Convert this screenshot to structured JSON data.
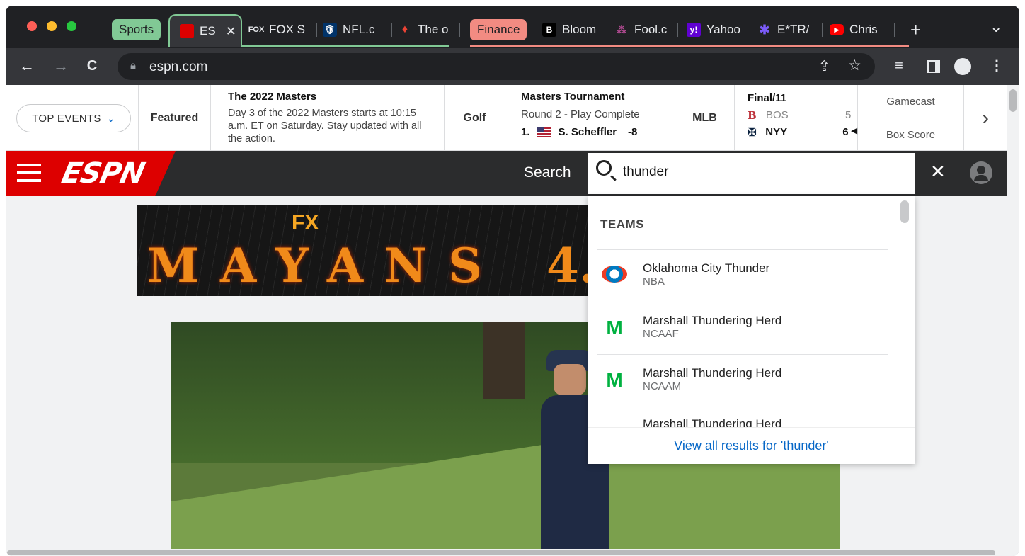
{
  "tabs": {
    "groups": [
      {
        "label": "Sports",
        "color": "#81c995"
      },
      {
        "label": "Finance",
        "color": "#f28b82"
      }
    ],
    "items": [
      {
        "title": "ES",
        "icon": "espn-favicon",
        "active": true
      },
      {
        "title": "FOX S",
        "icon": "fox-sports-favicon"
      },
      {
        "title": "NFL.c",
        "icon": "nfl-favicon"
      },
      {
        "title": "The o",
        "icon": "diamond-favicon"
      },
      {
        "title": "Bloom",
        "icon": "bloomberg-favicon"
      },
      {
        "title": "Fool.c",
        "icon": "fool-favicon"
      },
      {
        "title": "Yahoo",
        "icon": "yahoo-favicon"
      },
      {
        "title": "E*TR/",
        "icon": "etrade-favicon"
      },
      {
        "title": "Chris",
        "icon": "youtube-favicon"
      }
    ],
    "close_glyph": "✕",
    "new_tab_glyph": "+",
    "tab_search_glyph": "⌄"
  },
  "toolbar": {
    "url": "espn.com",
    "back": "←",
    "forward": "→",
    "reload": "C"
  },
  "scorebar": {
    "top_events": "TOP EVENTS",
    "featured_label": "Featured",
    "featured_title": "The 2022 Masters",
    "featured_text": "Day 3 of the 2022 Masters starts at 10:15 a.m. ET on Saturday. Stay updated with all the action.",
    "golf_label": "Golf",
    "golf_title": "Masters Tournament",
    "golf_status": "Round 2 - Play Complete",
    "golf_rank": "1.",
    "golf_player": "S. Scheffler",
    "golf_score": "-8",
    "mlb_label": "MLB",
    "mlb_status": "Final/11",
    "team1": "BOS",
    "team1_score": "5",
    "team2": "NYY",
    "team2_score": "6",
    "gamecast": "Gamecast",
    "box_score": "Box Score"
  },
  "search": {
    "label": "Search",
    "query": "thunder",
    "section": "TEAMS",
    "results": [
      {
        "name": "Oklahoma City Thunder",
        "league": "NBA"
      },
      {
        "name": "Marshall Thundering Herd",
        "league": "NCAAF"
      },
      {
        "name": "Marshall Thundering Herd",
        "league": "NCAAM"
      },
      {
        "name": "Marshall Thundering Herd",
        "league": ""
      }
    ],
    "view_all": "View all results for 'thunder'"
  },
  "banner": {
    "brand": "FX",
    "title": "MAYANS",
    "number": "4."
  },
  "colors": {
    "espn_red": "#d00",
    "link_blue": "#0667c7"
  }
}
